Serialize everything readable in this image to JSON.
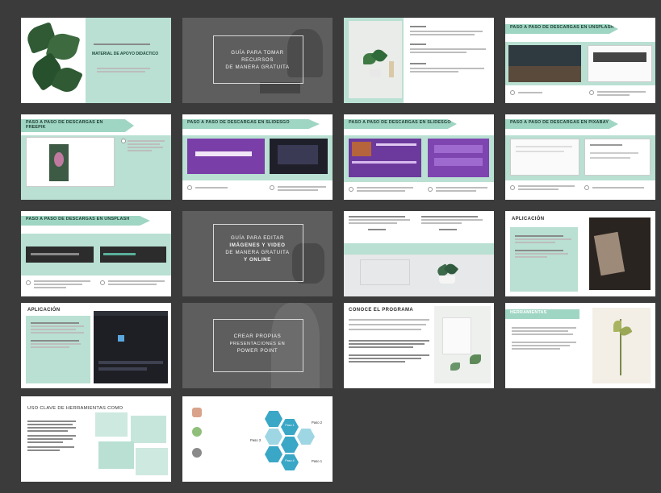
{
  "colors": {
    "background": "#3b3b3b",
    "accent_mint": "#b9e0d2",
    "banner": "#9fd6c3",
    "dark_slide": "#5e5e5e",
    "hex_blue": "#3aa7c7"
  },
  "slides": [
    {
      "index": 1,
      "title": "MATERIAL DE APOYO DIDÁCTICO"
    },
    {
      "index": 2,
      "lines": [
        "GUÍA PARA TOMAR",
        "RECURSOS",
        "DE MANERA GRATUITA"
      ]
    },
    {
      "index": 3,
      "title": ""
    },
    {
      "index": 4,
      "banner": "PASO A PASO DE DESCARGAS EN UNSPLASH"
    },
    {
      "index": 5,
      "banner": "PASO A PASO DE DESCARGAS EN FREEPIK"
    },
    {
      "index": 6,
      "banner": "PASO A PASO DE DESCARGAS EN SLIDESGO"
    },
    {
      "index": 7,
      "banner": "PASO A PASO DE DESCARGAS EN SLIDESGO"
    },
    {
      "index": 8,
      "banner": "PASO A PASO DE DESCARGAS EN PIXABAY"
    },
    {
      "index": 9,
      "banner": "PASO A PASO DE DESCARGAS EN UNSPLASH"
    },
    {
      "index": 10,
      "lines": [
        "GUÍA PARA EDITAR",
        "IMÁGENES Y VIDEO",
        "DE MANERA GRATUITA",
        "Y ONLINE"
      ]
    },
    {
      "index": 11,
      "title": ""
    },
    {
      "index": 12,
      "title": "APLICACIÓN"
    },
    {
      "index": 13,
      "title": "APLICACIÓN"
    },
    {
      "index": 14,
      "lines": [
        "CREAR PROPIAS",
        "PRESENTACIONES EN",
        "POWER POINT"
      ]
    },
    {
      "index": 15,
      "title": "CONOCE EL PROGRAMA"
    },
    {
      "index": 16,
      "title": "HERRAMIENTAS"
    },
    {
      "index": 17,
      "title": "USO CLAVE DE HERRAMIENTAS COMO"
    },
    {
      "index": 18,
      "hex_labels": [
        "Paso 1",
        "Paso 2",
        "Paso 3",
        "Paso 4",
        "Paso 1",
        "Paso 2",
        "Paso 3"
      ]
    }
  ]
}
